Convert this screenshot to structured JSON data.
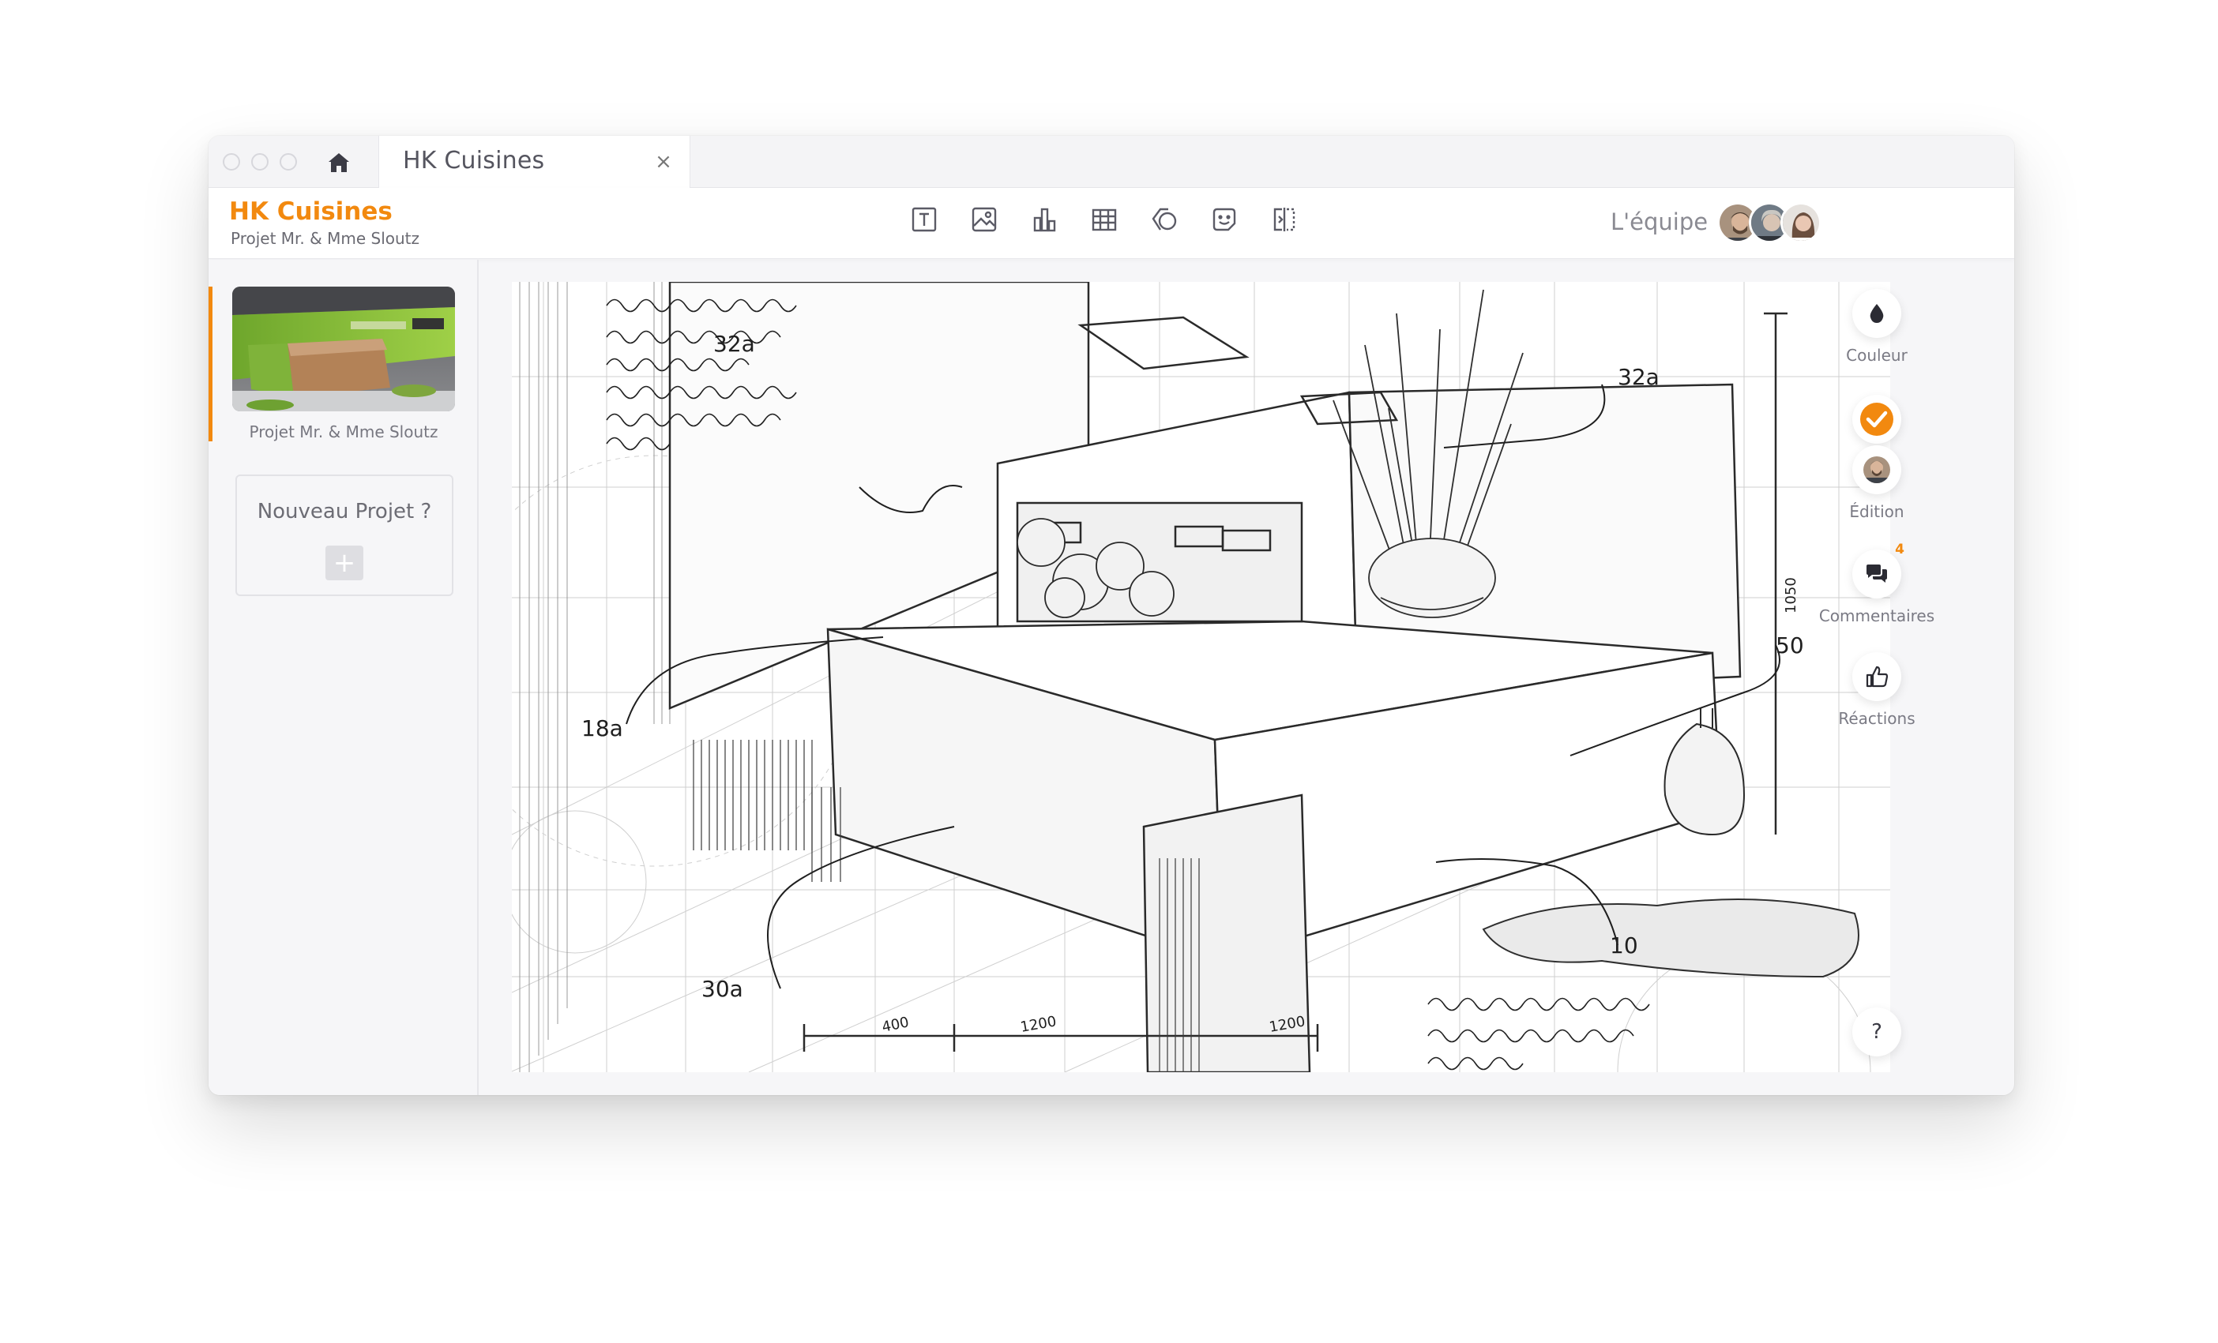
{
  "tab": {
    "title": "HK Cuisines",
    "close_symbol": "×"
  },
  "toolbar": {
    "brand_title": "HK Cuisines",
    "brand_subtitle": "Projet Mr. & Mme Sloutz",
    "tools": [
      "text-tool-icon",
      "image-tool-icon",
      "chart-tool-icon",
      "table-tool-icon",
      "shape-tool-icon",
      "sticker-tool-icon",
      "compare-tool-icon"
    ],
    "team_label": "L'équipe"
  },
  "sidebar": {
    "project_label": "Projet Mr. & Mme Sloutz",
    "new_project_label": "Nouveau Projet ?",
    "add_symbol": "+"
  },
  "rail": {
    "color_label": "Couleur",
    "edit_label": "Édition",
    "comments_label": "Commentaires",
    "comments_count": "4",
    "reactions_label": "Réactions",
    "help_symbol": "?"
  },
  "canvas": {
    "annotations": [
      "32a",
      "18a",
      "30a",
      "10",
      "400",
      "1200",
      "1200",
      "1050",
      "50"
    ]
  },
  "colors": {
    "accent": "#f2890f",
    "text_muted": "#6a6a72"
  }
}
